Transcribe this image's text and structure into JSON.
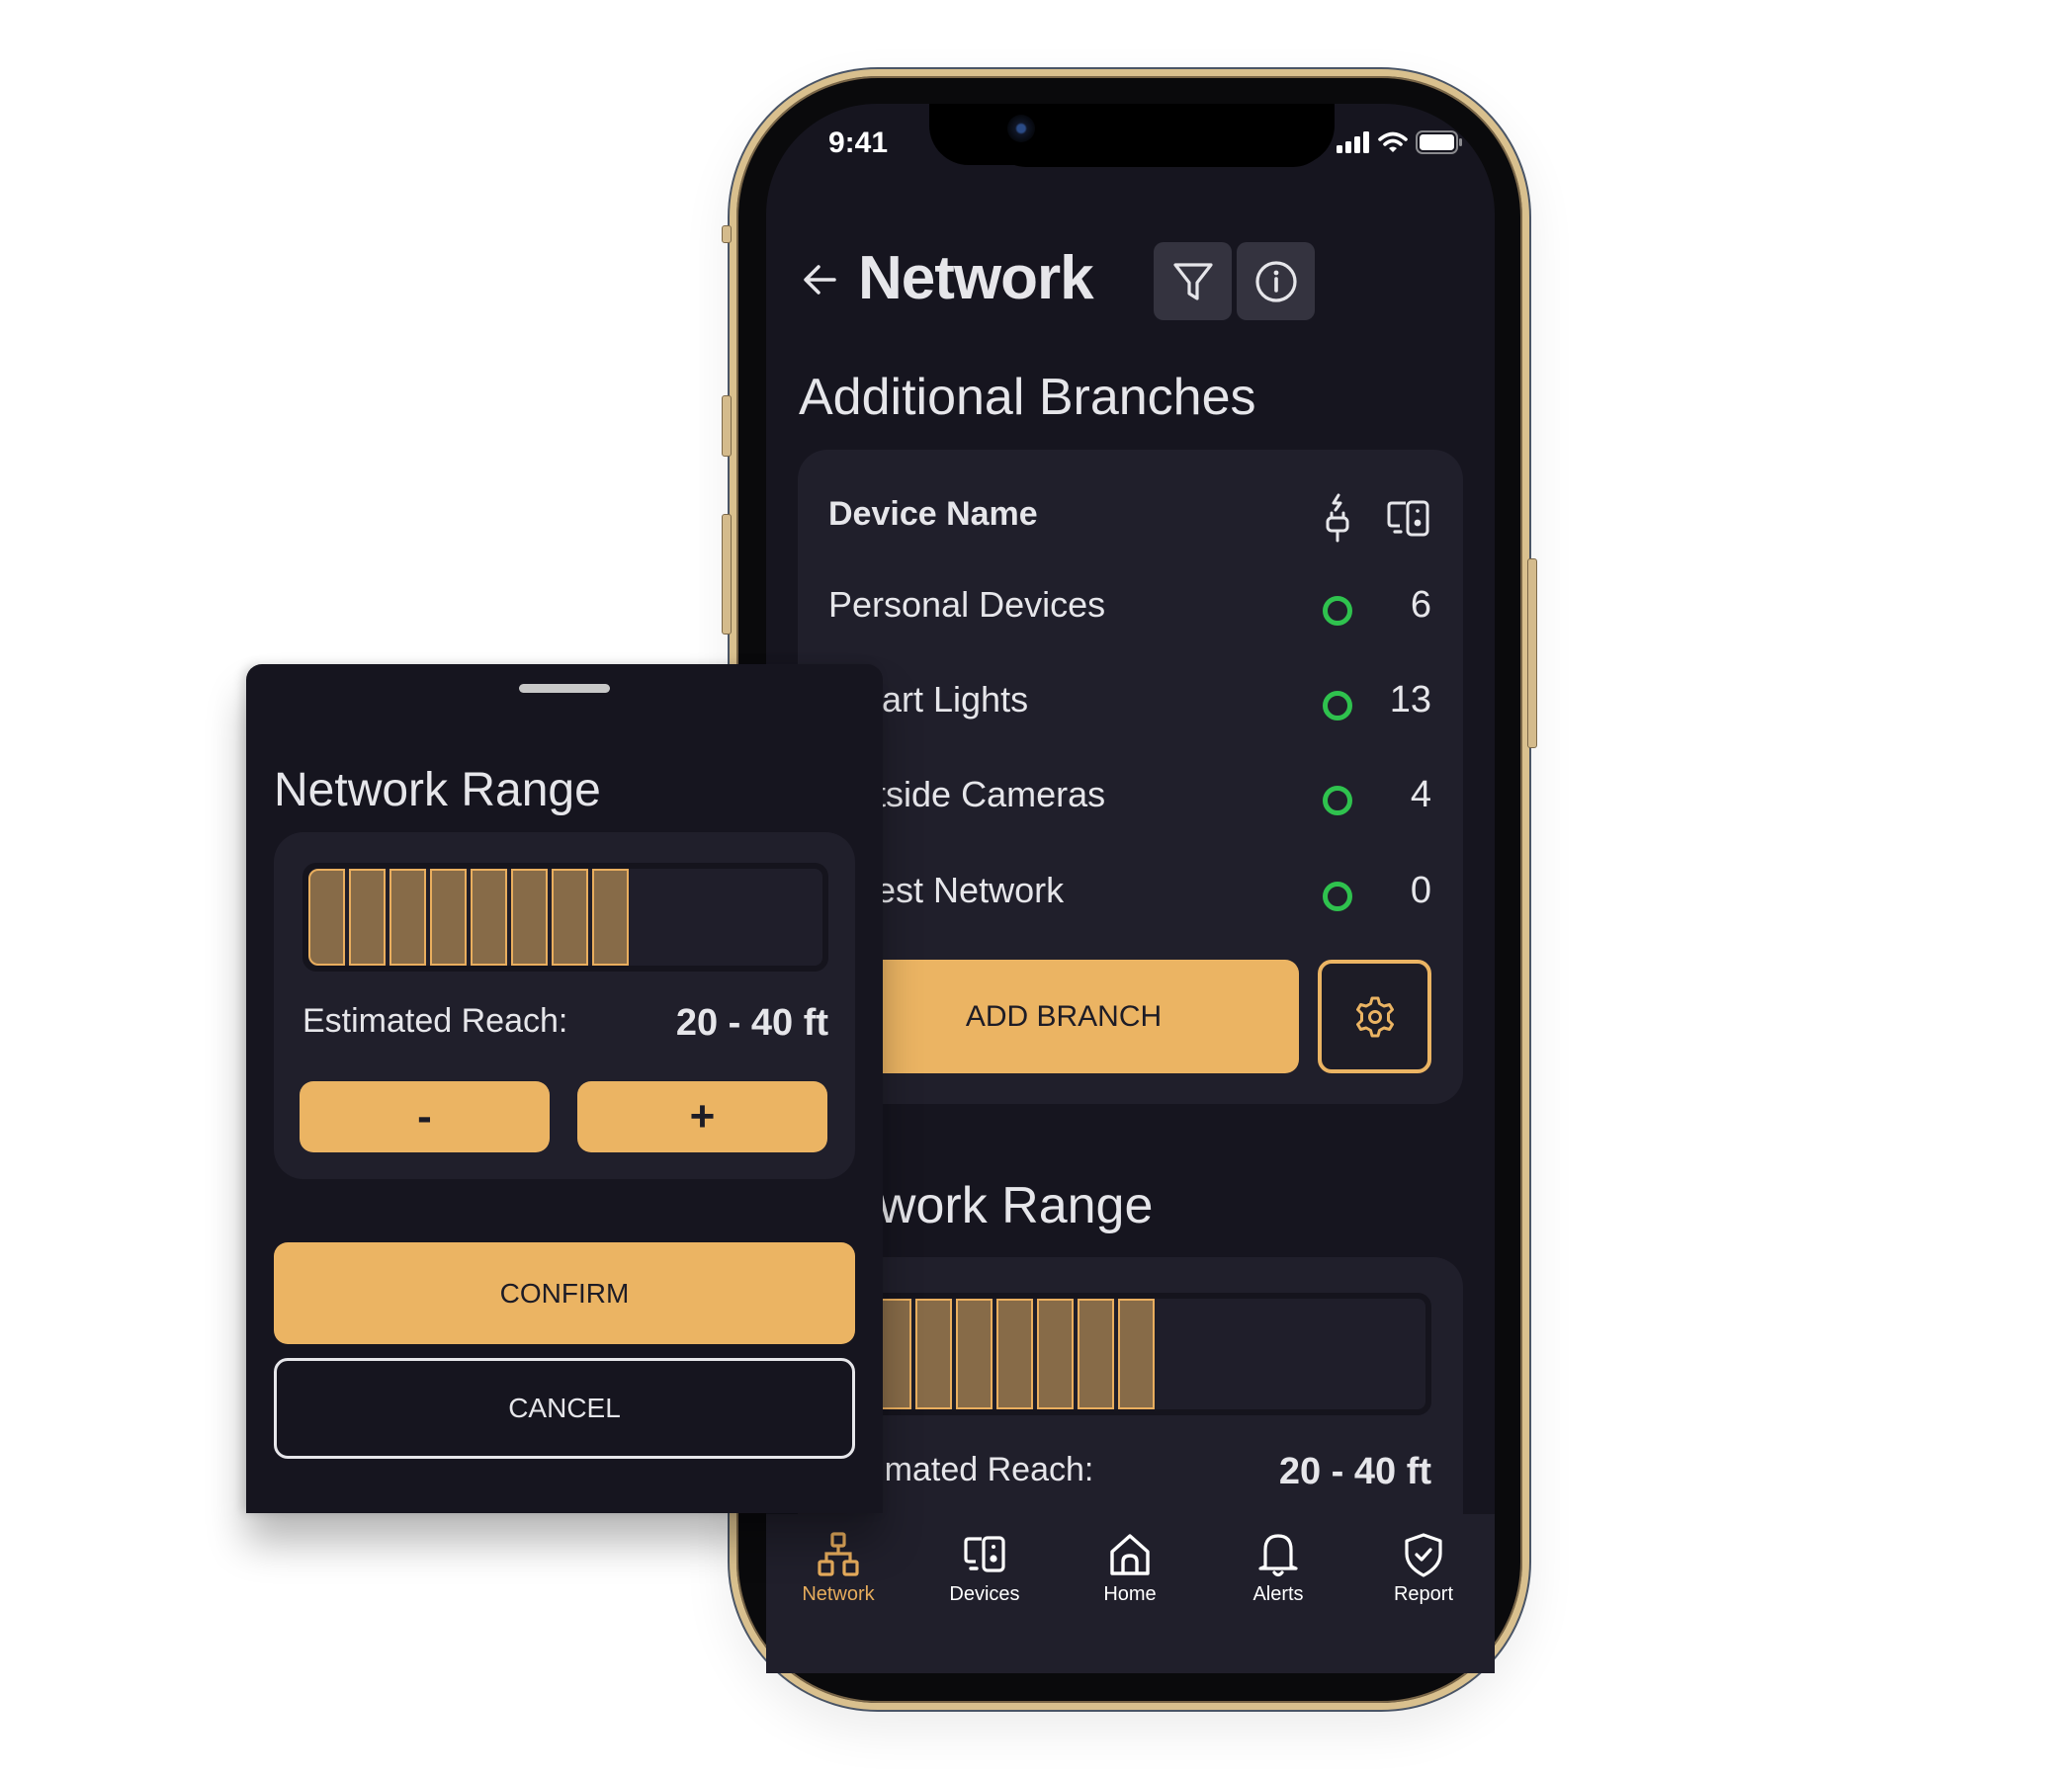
{
  "status_bar": {
    "time": "9:41",
    "icons": [
      "cellular-signal-icon",
      "wifi-icon",
      "battery-icon"
    ]
  },
  "header": {
    "back_icon": "arrow-left-icon",
    "title": "Network",
    "actions": [
      {
        "name": "filter",
        "icon": "filter-icon"
      },
      {
        "name": "info",
        "icon": "info-icon"
      }
    ]
  },
  "branches": {
    "title": "Additional Branches",
    "table": {
      "header": "Device Name",
      "header_icons": [
        "power-plug-icon",
        "devices-icon"
      ],
      "rows": [
        {
          "label": "Personal Devices",
          "status": "online",
          "count": "6"
        },
        {
          "label": "Smart Lights",
          "status": "online",
          "count": "13"
        },
        {
          "label": "Outside Cameras",
          "status": "online",
          "count": "4"
        },
        {
          "label": "Guest Network",
          "status": "online",
          "count": "0"
        }
      ]
    },
    "add_button": "ADD BRANCH",
    "settings_icon": "gear-icon"
  },
  "range": {
    "title": "Network Range",
    "level": 8,
    "level_max": 13,
    "reach_label": "Estimated Reach:",
    "reach_value": "20 - 40 ft"
  },
  "nav": {
    "items": [
      {
        "label": "Network",
        "icon": "network-icon",
        "active": true
      },
      {
        "label": "Devices",
        "icon": "devices-icon",
        "active": false
      },
      {
        "label": "Home",
        "icon": "home-icon",
        "active": false
      },
      {
        "label": "Alerts",
        "icon": "bell-icon",
        "active": false
      },
      {
        "label": "Report",
        "icon": "shield-check-icon",
        "active": false
      }
    ]
  },
  "sheet": {
    "title": "Network Range",
    "level": 8,
    "level_max": 13,
    "reach_label": "Estimated Reach:",
    "reach_value": "20 - 40 ft",
    "decrease_label": "-",
    "increase_label": "+",
    "confirm_label": "CONFIRM",
    "cancel_label": "CANCEL"
  },
  "colors": {
    "accent": "#ebb463",
    "segment_fill": "#876b48",
    "online": "#2fc24e",
    "background": "#16151f",
    "card": "#201f2b"
  }
}
